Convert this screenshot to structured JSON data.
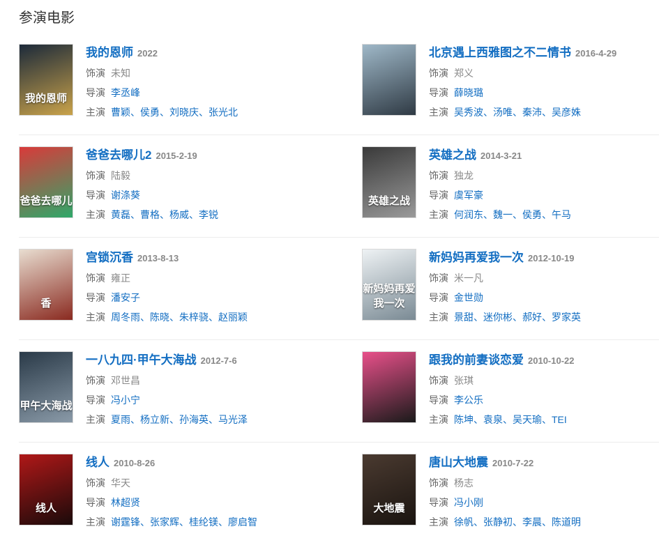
{
  "section": {
    "title": "参演电影"
  },
  "labels": {
    "role": "饰演",
    "director": "导演",
    "cast": "主演"
  },
  "movies": [
    {
      "title": "我的恩师",
      "date": "2022",
      "role": "未知",
      "director": "李丞峰",
      "cast": [
        "曹颖",
        "侯勇",
        "刘晓庆",
        "张光北"
      ],
      "poster_text": "我的恩师",
      "poster_colors": [
        "#1c2a3a",
        "#c9a24a"
      ]
    },
    {
      "title": "北京遇上西雅图之不二情书",
      "date": "2016-4-29",
      "role": "郑义",
      "director": "薛晓璐",
      "cast": [
        "吴秀波",
        "汤唯",
        "秦沛",
        "吴彦姝"
      ],
      "poster_text": "",
      "poster_colors": [
        "#9fb8c8",
        "#2f3a44"
      ]
    },
    {
      "title": "爸爸去哪儿2",
      "date": "2015-2-19",
      "role": "陆毅",
      "director": "谢涤葵",
      "cast": [
        "黄磊",
        "曹格",
        "杨威",
        "李锐"
      ],
      "poster_text": "爸爸去哪儿",
      "poster_colors": [
        "#d93a3a",
        "#2fa86a"
      ]
    },
    {
      "title": "英雄之战",
      "date": "2014-3-21",
      "role": "独龙",
      "director": "虞军豪",
      "cast": [
        "何润东",
        "魏一",
        "侯勇",
        "午马"
      ],
      "poster_text": "英雄之战",
      "poster_colors": [
        "#3a3a3a",
        "#9a9a9a"
      ]
    },
    {
      "title": "宫锁沉香",
      "date": "2013-8-13",
      "role": "雍正",
      "director": "潘安子",
      "cast": [
        "周冬雨",
        "陈晓",
        "朱梓骁",
        "赵丽颖"
      ],
      "poster_text": "香",
      "poster_colors": [
        "#e8ddd0",
        "#8a2a20"
      ]
    },
    {
      "title": "新妈妈再爱我一次",
      "date": "2012-10-19",
      "role": "米一凡",
      "director": "金世勋",
      "cast": [
        "景甜",
        "迷你彬",
        "郝好",
        "罗家英"
      ],
      "poster_text": "新妈妈再爱我一次",
      "poster_colors": [
        "#eef2f4",
        "#7a8a94"
      ]
    },
    {
      "title": "一八九四·甲午大海战",
      "date": "2012-7-6",
      "role": "邓世昌",
      "director": "冯小宁",
      "cast": [
        "夏雨",
        "杨立新",
        "孙海英",
        "马光泽"
      ],
      "poster_text": "甲午大海战",
      "poster_colors": [
        "#2a3a48",
        "#8a9aa8"
      ]
    },
    {
      "title": "跟我的前妻谈恋爱",
      "date": "2010-10-22",
      "role": "张琪",
      "director": "李公乐",
      "cast": [
        "陈坤",
        "袁泉",
        "吴天瑜",
        "TEI"
      ],
      "poster_text": "",
      "poster_colors": [
        "#e8508a",
        "#1a1a1a"
      ]
    },
    {
      "title": "线人",
      "date": "2010-8-26",
      "role": "华天",
      "director": "林超贤",
      "cast": [
        "谢霆锋",
        "张家辉",
        "桂纶镁",
        "廖启智"
      ],
      "poster_text": "线人",
      "poster_colors": [
        "#b01818",
        "#1a0a0a"
      ]
    },
    {
      "title": "唐山大地震",
      "date": "2010-7-22",
      "role": "杨志",
      "director": "冯小刚",
      "cast": [
        "徐帆",
        "张静初",
        "李晨",
        "陈道明"
      ],
      "poster_text": "大地震",
      "poster_colors": [
        "#4a3a30",
        "#1a1410"
      ]
    }
  ]
}
